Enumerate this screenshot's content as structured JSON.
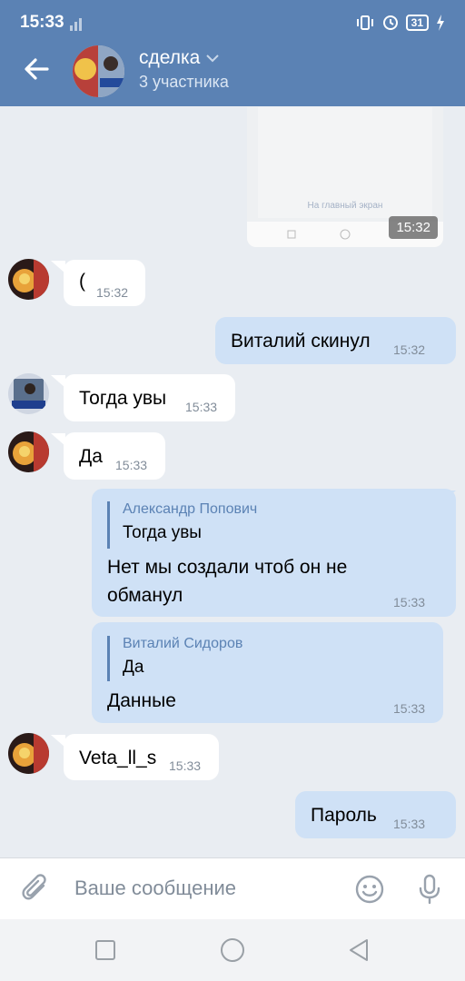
{
  "status": {
    "time": "15:33",
    "battery": "31"
  },
  "chat": {
    "title": "сделка",
    "subtitle": "3 участника"
  },
  "photo": {
    "hint": "На главный экран",
    "time": "15:32"
  },
  "messages": [
    {
      "text": "(",
      "time": "15:32"
    },
    {
      "text": "Виталий скинул",
      "time": "15:32"
    },
    {
      "text": "Тогда увы",
      "time": "15:33"
    },
    {
      "text": "Да",
      "time": "15:33"
    },
    {
      "reply_name": "Александр Попович",
      "reply_text": "Тогда увы",
      "text1": "Нет мы создали чтоб он не",
      "text2": "обманул",
      "time": "15:33"
    },
    {
      "reply_name": "Виталий Сидоров",
      "reply_text": "Да",
      "text": "Данные",
      "time": "15:33"
    },
    {
      "text": "Veta_ll_s",
      "time": "15:33"
    },
    {
      "text": "Пароль",
      "time": "15:33"
    }
  ],
  "composer": {
    "placeholder": "Ваше сообщение"
  },
  "colors": {
    "header": "#5b82b4",
    "incoming": "#ffffff",
    "outgoing": "#cfe1f6",
    "background": "#e9edf2"
  }
}
